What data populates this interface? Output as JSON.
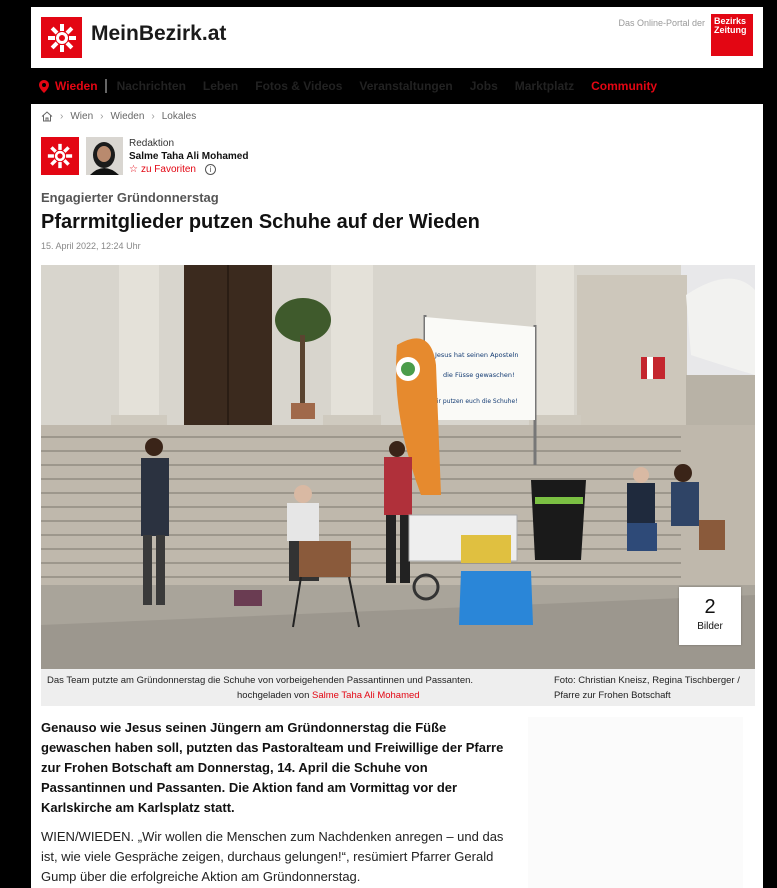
{
  "header": {
    "brand": "MeinBezirk.at",
    "portal_text": "Das Online-Portal der",
    "partner_logo_text": "Bezirks Zeitung"
  },
  "nav": {
    "items": [
      {
        "label": "Wieden",
        "active": true
      },
      {
        "label": "Nachrichten"
      },
      {
        "label": "Leben"
      },
      {
        "label": "Fotos & Videos"
      },
      {
        "label": "Veranstaltungen"
      },
      {
        "label": "Jobs"
      },
      {
        "label": "Marktplatz"
      },
      {
        "label": "Community",
        "highlight": true
      }
    ]
  },
  "breadcrumb": [
    "Wien",
    "Wieden",
    "Lokales"
  ],
  "author": {
    "role": "Redaktion",
    "name": "Salme Taha Ali Mohamed",
    "favorite_label": "zu Favoriten",
    "info_glyph": "i"
  },
  "article": {
    "kicker": "Engagierter Gründonnerstag",
    "title": "Pfarrmitglieder putzen Schuhe auf der Wieden",
    "date": "15. April 2022, 12:24 Uhr",
    "photo": {
      "count": "2",
      "count_label": "Bilder",
      "banner_line1": "Jesus hat seinen Aposteln",
      "banner_line2": "die Füsse gewaschen!",
      "banner_line3": "Wir putzen euch die Schuhe!"
    },
    "caption": "Das Team putzte am Gründonnerstag die Schuhe von vorbeigehenden Passantinnen und Passanten.",
    "credit": "Foto: Christian Kneisz, Regina Tischberger / Pfarre zur Frohen Botschaft",
    "uploaded_label": "hochgeladen von",
    "uploaded_by": "Salme Taha Ali Mohamed",
    "lead": "Genauso wie Jesus seinen Jüngern am Gründonnerstag die Füße gewaschen haben soll, putzten das Pastoralteam und Freiwillige der Pfarre zur Frohen Botschaft am Donnerstag, 14. April die Schuhe von Passantinnen und Passanten. Die Aktion fand am Vormittag vor der Karlskirche am Karlsplatz statt.",
    "body": "WIEN/WIEDEN. „Wir wollen die Menschen zum Nachdenken anregen – und das ist, wie viele Gespräche zeigen, durchaus gelungen!“, resümiert Pfarrer Gerald Gump über die erfolgreiche Aktion am Gründonnerstag."
  },
  "colors": {
    "brand_red": "#e30613",
    "nav_bg": "#000000"
  }
}
